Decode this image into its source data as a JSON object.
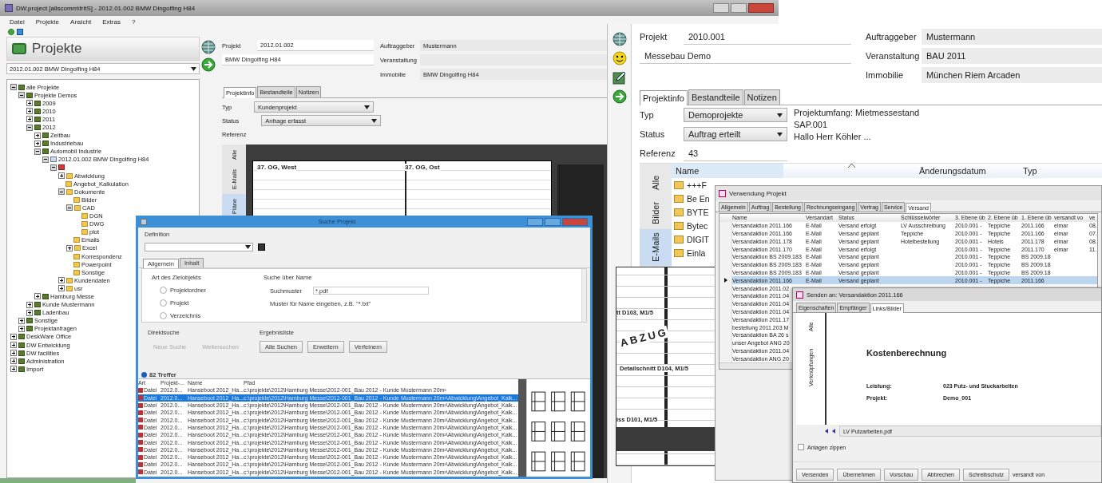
{
  "main_window": {
    "title": "DW.project [allscomm\\fritS] - 2012.01.002 BMW Dingolfing H84",
    "menu": [
      "Datei",
      "Projekte",
      "Ansicht",
      "Extras",
      "?"
    ],
    "panel_title": "Projekte",
    "project_select": "2012.01.002 BMW Dingolfing H84",
    "tree": [
      {
        "label": "alle Projekte",
        "kind": "group",
        "expanded": true,
        "children": [
          {
            "label": "Projekte Demos",
            "kind": "group",
            "expanded": true,
            "children": [
              {
                "label": "2009",
                "kind": "group",
                "expanded": false
              },
              {
                "label": "2010",
                "kind": "group",
                "expanded": false
              },
              {
                "label": "2011",
                "kind": "group",
                "expanded": false
              },
              {
                "label": "2012",
                "kind": "group",
                "expanded": true,
                "children": [
                  {
                    "label": "Zeitbau",
                    "kind": "group",
                    "expanded": false
                  },
                  {
                    "label": "Industriebau",
                    "kind": "group",
                    "expanded": false
                  },
                  {
                    "label": "Automobil Industrie",
                    "kind": "group",
                    "expanded": true,
                    "children": [
                      {
                        "label": "2012.01.002 BMW Dingolfing H84",
                        "kind": "project",
                        "expanded": true,
                        "children": [
                          {
                            "kind": "red-folder",
                            "expanded": true,
                            "children": [
                              {
                                "label": "Abwicklung",
                                "kind": "folder",
                                "expanded": false
                              },
                              {
                                "label": "Angebot_Kalkulation",
                                "kind": "folder"
                              },
                              {
                                "label": "Dokumente",
                                "kind": "folder",
                                "expanded": true,
                                "children": [
                                  {
                                    "label": "Bilder",
                                    "kind": "folder"
                                  },
                                  {
                                    "label": "CAD",
                                    "kind": "folder",
                                    "expanded": true,
                                    "children": [
                                      {
                                        "label": "DGN",
                                        "kind": "folder"
                                      },
                                      {
                                        "label": "DWG",
                                        "kind": "folder"
                                      },
                                      {
                                        "label": "plot",
                                        "kind": "folder"
                                      }
                                    ]
                                  },
                                  {
                                    "label": "Emails",
                                    "kind": "folder"
                                  },
                                  {
                                    "label": "Excel",
                                    "kind": "folder",
                                    "expanded": false
                                  },
                                  {
                                    "label": "Korrespondenz",
                                    "kind": "folder"
                                  },
                                  {
                                    "label": "Powerpoint",
                                    "kind": "folder"
                                  },
                                  {
                                    "label": "Sonstige",
                                    "kind": "folder"
                                  }
                                ]
                              },
                              {
                                "label": "Kundendaten",
                                "kind": "folder",
                                "expanded": false
                              },
                              {
                                "label": "usr",
                                "kind": "folder",
                                "expanded": false
                              }
                            ]
                          }
                        ]
                      }
                    ]
                  },
                  {
                    "label": "Hamburg Messe",
                    "kind": "group",
                    "expanded": false
                  }
                ]
              },
              {
                "label": "Kunde Mustermann",
                "kind": "group",
                "expanded": false
              },
              {
                "label": "Ladenbau",
                "kind": "group",
                "expanded": false
              }
            ]
          },
          {
            "label": "Sonstige",
            "kind": "group",
            "expanded": false
          },
          {
            "label": "Projektanfragen",
            "kind": "group",
            "expanded": false
          }
        ]
      },
      {
        "label": "DeskWare Office",
        "kind": "group",
        "expanded": false
      },
      {
        "label": "DW Entwicklung",
        "kind": "group",
        "expanded": false
      },
      {
        "label": "DW facilities",
        "kind": "group",
        "expanded": false
      },
      {
        "label": "Administration",
        "kind": "group",
        "expanded": false
      },
      {
        "label": "Import",
        "kind": "group",
        "expanded": false
      }
    ],
    "left_fields": [
      {
        "label": "Projekt",
        "value": "2012.01.002"
      },
      {
        "value": "BMW Dingolfing H84"
      }
    ],
    "right_fields": [
      {
        "label": "Auftraggeber",
        "value": "Mustermann"
      },
      {
        "label": "Veranstaltung"
      },
      {
        "label": "Immobilie",
        "value": "BMW Dingolfing H84"
      }
    ],
    "tabs": [
      {
        "label": "Projektinfo",
        "selected": true
      },
      {
        "label": "Bestandteile",
        "selected": false
      },
      {
        "label": "Notizen",
        "selected": false
      }
    ],
    "typ_label": "Typ",
    "typ": "Kundenprojekt",
    "status_label": "Status",
    "status": "Anfrage erfasst",
    "referenz_label": "Referenz",
    "side_tabs": [
      {
        "label": "Alle",
        "selected": false
      },
      {
        "label": "E-Mails",
        "selected": false
      },
      {
        "label": "Pläne",
        "selected": true
      }
    ],
    "drawing_labels": [
      "37. OG, West",
      "37. OG, Ost"
    ]
  },
  "project_window": {
    "left_fields": [
      {
        "label": "Projekt",
        "value": "2010.001"
      },
      {
        "value": "Messebau Demo"
      }
    ],
    "right_fields": [
      {
        "label": "Auftraggeber",
        "value": "Mustermann"
      },
      {
        "label": "Veranstaltung",
        "value": "BAU 2011"
      },
      {
        "label": "Immobilie",
        "value": "München Riem Arcaden"
      }
    ],
    "tabs": [
      {
        "label": "Projektinfo",
        "selected": true
      },
      {
        "label": "Bestandteile",
        "selected": false
      },
      {
        "label": "Notizen",
        "selected": false
      }
    ],
    "typ_label": "Typ",
    "typ": "Demoprojekte",
    "status_label": "Status",
    "status": "Auftrag erteilt",
    "referenz_label": "Referenz",
    "referenz": "43",
    "notes": [
      "Projektumfang: Mietmessestand",
      "SAP.001",
      "Hallo Herr Köhler ..."
    ],
    "side_tabs": [
      {
        "label": "Alle",
        "selected": false
      },
      {
        "label": "Bilder",
        "selected": false
      },
      {
        "label": "E-Mails",
        "selected": true
      }
    ],
    "columns": [
      "Name",
      "Änderungsdatum",
      "Typ"
    ],
    "files": [
      "+++F",
      "Be En",
      "BYTE",
      "Bytec",
      "DIGIT",
      "Einla"
    ],
    "drawing_labels": [
      "tt D103, M1/5",
      "ABZUG",
      "Detailschnitt D104, M1/5",
      "iss D101, M1/5"
    ]
  },
  "search_dialog": {
    "title": "Suche Projekt",
    "definition_label": "Definition",
    "tabs": [
      {
        "label": "Allgemein",
        "selected": true
      },
      {
        "label": "Inhalt",
        "selected": false
      }
    ],
    "target_title": "Art des Zielobjekts",
    "targets": [
      {
        "label": "Projektordner",
        "selected": false
      },
      {
        "label": "Projekt",
        "selected": false
      },
      {
        "label": "Verzeichnis",
        "selected": false
      }
    ],
    "name_title": "Suche über Name",
    "pattern_label": "Suchmuster",
    "pattern": "*.pdf",
    "hint": "Muster für Name eingeben, z.B. \"*.txt\"",
    "direct_title": "Direktsuche",
    "direct_buttons": [
      {
        "label": "Neue Suche",
        "disabled": true
      },
      {
        "label": "Weitersuchen",
        "disabled": true
      }
    ],
    "result_title": "Ergebnisliste",
    "result_buttons": [
      "Alle Suchen",
      "Erweitern",
      "Verfeinern"
    ],
    "hits": "82 Treffer",
    "columns": [
      "Art",
      "Projekt-...",
      "Name",
      "Pfad"
    ],
    "rows": [
      {
        "art": "Datei",
        "projekt": "2012.0...",
        "name": "Hanseboot 2012_Ha...",
        "pfad": "c:\\projekte\\2012\\Hamburg Messe\\2012-001_Bau 2012 - Kunde Mustermann 20m²",
        "selected": false
      },
      {
        "art": "Datei",
        "projekt": "2012.0...",
        "name": "Hanseboot 2012_Ha...",
        "pfad": "c:\\projekte\\2012\\Hamburg Messe\\2012-001_Bau 2012 - Kunde Mustermann 20m²\\Abwicklung\\Angebot_Kalk...",
        "selected": true
      },
      {
        "art": "Datei",
        "projekt": "2012.0...",
        "name": "Hanseboot 2012_Ha...",
        "pfad": "c:\\projekte\\2012\\Hamburg Messe\\2012-001_Bau 2012 - Kunde Mustermann 20m²\\Abwicklung\\Angebot_Kalk...",
        "selected": false
      },
      {
        "art": "Datei",
        "projekt": "2012.0...",
        "name": "Hanseboot 2012_Ha...",
        "pfad": "c:\\projekte\\2012\\Hamburg Messe\\2012-001_Bau 2012 - Kunde Mustermann 20m²\\Abwicklung\\Angebot_Kalk...",
        "selected": false
      },
      {
        "art": "Datei",
        "projekt": "2012.0...",
        "name": "Hanseboot 2012_Ha...",
        "pfad": "c:\\projekte\\2012\\Hamburg Messe\\2012-001_Bau 2012 - Kunde Mustermann 20m²\\Abwicklung\\Angebot_Kalk...",
        "selected": false
      },
      {
        "art": "Datei",
        "projekt": "2012.0...",
        "name": "Hanseboot 2012_Ha...",
        "pfad": "c:\\projekte\\2012\\Hamburg Messe\\2012-001_Bau 2012 - Kunde Mustermann 20m²\\Abwicklung\\Angebot_Kalk...",
        "selected": false
      },
      {
        "art": "Datei",
        "projekt": "2012.0...",
        "name": "Hanseboot 2012_Ha...",
        "pfad": "c:\\projekte\\2012\\Hamburg Messe\\2012-001_Bau 2012 - Kunde Mustermann 20m²\\Abwicklung\\Angebot_Kalk...",
        "selected": false
      },
      {
        "art": "Datei",
        "projekt": "2012.0...",
        "name": "Hanseboot 2012_Ha...",
        "pfad": "c:\\projekte\\2012\\Hamburg Messe\\2012-001_Bau 2012 - Kunde Mustermann 20m²\\Abwicklung\\Angebot_Kalk...",
        "selected": false
      },
      {
        "art": "Datei",
        "projekt": "2012.0...",
        "name": "Hanseboot 2012_Ha...",
        "pfad": "c:\\projekte\\2012\\Hamburg Messe\\2012-001_Bau 2012 - Kunde Mustermann 20m²\\Abwicklung\\Angebot_Kalk...",
        "selected": false
      },
      {
        "art": "Datei",
        "projekt": "2012.0...",
        "name": "Hanseboot 2012_Ha...",
        "pfad": "c:\\projekte\\2012\\Hamburg Messe\\2012-001_Bau 2012 - Kunde Mustermann 20m²\\Abwicklung\\Angebot_Kalk...",
        "selected": false
      },
      {
        "art": "Datei",
        "projekt": "2012.0...",
        "name": "Hanseboot 2012_Ha...",
        "pfad": "c:\\projekte\\2012\\Hamburg Messe\\2012-001_Bau 2012 - Kunde Mustermann 20m²\\Abwicklung\\Angebot_Kalk...",
        "selected": false
      },
      {
        "art": "Datei",
        "projekt": "2012.0...",
        "name": "Hanseboot 2012_Ha...",
        "pfad": "c:\\projekte\\2012\\Hamburg Messe\\2012-001_Bau 2012 - Kunde Mustermann 20m²\\Abwicklung\\Angebot_Kalk...",
        "selected": false
      }
    ]
  },
  "usage_window": {
    "title": "Verwendung Projekt",
    "tabs": [
      {
        "label": "Allgemein",
        "selected": false
      },
      {
        "label": "Auftrag",
        "selected": false
      },
      {
        "label": "Bestellung",
        "selected": false
      },
      {
        "label": "Rechnungseingang",
        "selected": false
      },
      {
        "label": "Vertrag",
        "selected": false
      },
      {
        "label": "Service",
        "selected": false
      },
      {
        "label": "Versand",
        "selected": true
      }
    ],
    "columns": [
      "Name",
      "Versandart",
      "Status",
      "Schlüsselwörter",
      "3. Ebene üb",
      "2. Ebene üb",
      "1. Ebene üb",
      "versandt vo",
      "ve"
    ],
    "rows": [
      {
        "selected": false,
        "name": "Versandaktion 2011.166",
        "versandart": "E-Mail",
        "status": "Versand erfolgt",
        "keywords": "LV Ausschreibung",
        "level3": "2010.001 -",
        "level2": "Teppiche",
        "level1": "2011.166",
        "sender": "elmar",
        "column_9": "08."
      },
      {
        "selected": false,
        "name": "Versandaktion 2011.166",
        "versandart": "E-Mail",
        "status": "Versand geplant",
        "keywords": "Teppiche",
        "level3": "2010.001 -",
        "level2": "Teppiche",
        "level1": "2011.166",
        "sender": "elmar",
        "column_9": "07."
      },
      {
        "selected": false,
        "name": "Versandaktion 2011.178",
        "versandart": "E-Mail",
        "status": "Versand geplant",
        "keywords": "Hotelbestellung",
        "level3": "2010.001 -",
        "level2": "Hotels",
        "level1": "2011.178",
        "sender": "elmar",
        "column_9": "08."
      },
      {
        "selected": false,
        "name": "Versandaktion 2011.170",
        "versandart": "E-Mail",
        "status": "Versand erfolgt",
        "level3": "2010.001 -",
        "level2": "Teppiche",
        "level1": "2011.170",
        "sender": "elmar",
        "column_9": "11."
      },
      {
        "selected": false,
        "name": "Versandaktion BS 2009.183",
        "versandart": "E-Mail",
        "status": "Versand geplant",
        "level3": "2010.001 -",
        "level2": "Teppiche",
        "level1": "BS 2009.18"
      },
      {
        "selected": false,
        "name": "Versandaktion BS 2009.183",
        "versandart": "E-Mail",
        "status": "Versand geplant",
        "level3": "2010.001 -",
        "level2": "Teppiche",
        "level1": "BS 2009.18"
      },
      {
        "selected": false,
        "name": "Versandaktion BS 2009.183",
        "versandart": "E-Mail",
        "status": "Versand geplant",
        "level3": "2010.001 -",
        "level2": "Teppiche",
        "level1": "BS 2009.18"
      },
      {
        "selected": true,
        "name": "Versandaktion 2011.166",
        "versandart": "E-Mail",
        "status": "Versand geplant",
        "level3": "2010.001 -",
        "level2": "Teppiche",
        "level1": "2011.166"
      },
      {
        "selected": false,
        "name": "Versandaktion 2011.02"
      },
      {
        "selected": false,
        "name": "Versandaktion 2011.04"
      },
      {
        "selected": false,
        "name": "Versandaktion 2011.04"
      },
      {
        "selected": false,
        "name": "Versandaktion 2011.04"
      },
      {
        "selected": false,
        "name": "Versandaktion 2011.17"
      },
      {
        "selected": false,
        "name": "bestellung 2011.203 M"
      },
      {
        "selected": false,
        "name": "Versandaktion BA 26 s"
      },
      {
        "selected": false,
        "name": "unser Angebot ANG 20"
      },
      {
        "selected": false,
        "name": "Versandaktion 2011.04"
      },
      {
        "selected": false,
        "name": "Versandaktion ANG 20"
      }
    ]
  },
  "send_window": {
    "title": "Senden an: Versandaktion 2011.166",
    "tabs": [
      {
        "label": "Eigenschaften",
        "selected": false
      },
      {
        "label": "Empfänger",
        "selected": false
      },
      {
        "label": "Links/Bilder",
        "selected": true
      }
    ],
    "side_tabs": [
      {
        "label": "Alle",
        "selected": false
      },
      {
        "label": "Verknüpfungen",
        "selected": false
      }
    ],
    "doc_title": "Kostenberechnung",
    "doc_rows": [
      {
        "label": "Leistung:",
        "value": "023 Putz- und Stuckarbeiten"
      },
      {
        "label": "Projekt:",
        "value": "Demo_001"
      }
    ],
    "file": "LV Putzarbeiten.pdf",
    "zip": {
      "label": "Anlagen zippen",
      "checked": false
    },
    "buttons": [
      "Versenden",
      "Übernehmen",
      "Vorschau",
      "Abbrechen",
      "Schreibschutz"
    ],
    "sent_by": "versandt von"
  }
}
